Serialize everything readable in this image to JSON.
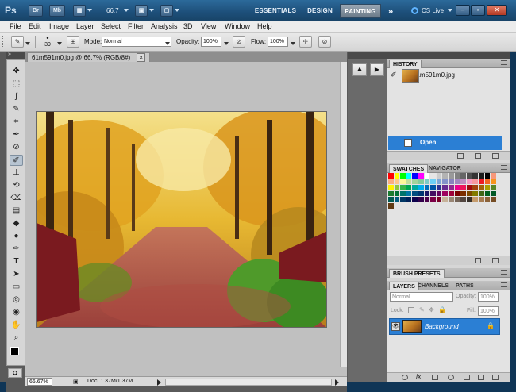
{
  "app": {
    "logo": "Ps",
    "bridge_label": "Br",
    "minibridge_label": "Mb",
    "zoom_level": "66.7",
    "workspaces": [
      "ESSENTIALS",
      "DESIGN",
      "PAINTING"
    ],
    "active_workspace": "PAINTING",
    "more_icon": "»",
    "cs_live": "CS Live"
  },
  "menu": [
    "File",
    "Edit",
    "Image",
    "Layer",
    "Select",
    "Filter",
    "Analysis",
    "3D",
    "View",
    "Window",
    "Help"
  ],
  "options_bar": {
    "brush_size": "39",
    "mode_label": "Mode:",
    "mode_value": "Normal",
    "opacity_label": "Opacity:",
    "opacity_value": "100%",
    "flow_label": "Flow:",
    "flow_value": "100%"
  },
  "document": {
    "tab_title": "61m591m0.jpg @ 66.7% (RGB/8#)",
    "tab_close": "×",
    "status_zoom": "66.67%",
    "status_doc": "Doc: 1.37M/1.37M"
  },
  "panels": {
    "history": {
      "tab": "HISTORY",
      "snapshot": "61m591m0.jpg",
      "step": "Open"
    },
    "swatches": {
      "tabs": [
        "SWATCHES",
        "NAVIGATOR"
      ],
      "active": "SWATCHES"
    },
    "brush_presets": {
      "tab": "BRUSH PRESETS"
    },
    "layers": {
      "tabs": [
        "LAYERS",
        "CHANNELS",
        "PATHS"
      ],
      "active": "LAYERS",
      "blend_mode": "Normal",
      "opacity_label": "Opacity:",
      "opacity_value": "100%",
      "lock_label": "Lock:",
      "fill_label": "Fill:",
      "fill_value": "100%",
      "layer_name": "Background"
    }
  },
  "colors": {
    "titlebar": "#1d4f7a",
    "selection_blue": "#2b7fd4",
    "canvas_bg": "#c0c0c0"
  },
  "swatches": [
    "#ff0000",
    "#ffff00",
    "#00ff00",
    "#00ffff",
    "#0000ff",
    "#ff00ff",
    "#ffffff",
    "#e6e6e6",
    "#cccccc",
    "#b3b3b3",
    "#999999",
    "#808080",
    "#666666",
    "#4d4d4d",
    "#333333",
    "#1a1a1a",
    "#000000",
    "#f7977a",
    "#f9ad81",
    "#fdc68a",
    "#fff79a",
    "#c4df9b",
    "#a2d39c",
    "#82ca9d",
    "#7bcdc8",
    "#6ecff6",
    "#7ea7d8",
    "#8493ca",
    "#8882be",
    "#a187be",
    "#bc8dbf",
    "#f49ac2",
    "#f6989d",
    "#ed1c24",
    "#f26522",
    "#f7941d",
    "#fff200",
    "#8dc63f",
    "#39b54a",
    "#00a651",
    "#00a99d",
    "#00aeef",
    "#0072bc",
    "#0054a6",
    "#2e3192",
    "#662d91",
    "#92278f",
    "#ec008c",
    "#ed145b",
    "#9e0b0f",
    "#a0410d",
    "#a36209",
    "#aba000",
    "#598527",
    "#1a7b30",
    "#007236",
    "#00746b",
    "#0076a3",
    "#004b80",
    "#003471",
    "#1b1464",
    "#440e62",
    "#630460",
    "#9e005d",
    "#9e0039",
    "#790000",
    "#7b2e00",
    "#7d4900",
    "#827b00",
    "#406618",
    "#005e20",
    "#005826",
    "#005952",
    "#005b7f",
    "#003663",
    "#002157",
    "#0d004c",
    "#32004b",
    "#4b0049",
    "#7b0046",
    "#7a0026",
    "#c7b299",
    "#998675",
    "#736357",
    "#534741",
    "#37302a",
    "#c69c6d",
    "#a67c52",
    "#8c6239",
    "#754c24",
    "#603913"
  ],
  "tools": [
    "move-tool",
    "marquee-tool",
    "lasso-tool",
    "quick-selection-tool",
    "crop-tool",
    "eyedropper-tool",
    "healing-brush-tool",
    "brush-tool",
    "clone-stamp-tool",
    "history-brush-tool",
    "eraser-tool",
    "gradient-tool",
    "blur-tool",
    "dodge-tool",
    "pen-tool",
    "type-tool",
    "path-selection-tool",
    "shape-tool",
    "3d-rotate-tool",
    "3d-orbit-tool",
    "hand-tool",
    "zoom-tool"
  ],
  "tool_glyphs": [
    "✥",
    "⬚",
    "ʃ",
    "✎",
    "⌗",
    "✒",
    "⊘",
    "✐",
    "⊥",
    "⟲",
    "⌫",
    "▤",
    "◆",
    "●",
    "✑",
    "T",
    "➤",
    "▭",
    "◎",
    "◉",
    "✋",
    "🔍"
  ]
}
